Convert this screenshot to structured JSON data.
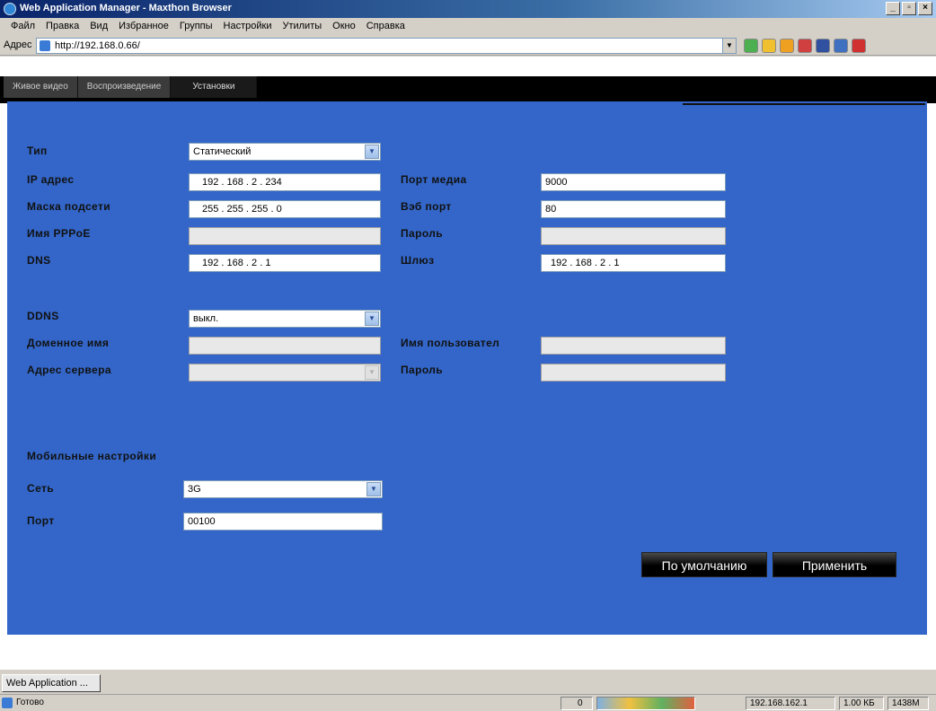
{
  "window": {
    "title": "Web Application Manager - Maxthon Browser",
    "minimize": "_",
    "maximize": "▫",
    "close": "×"
  },
  "menu": [
    "Файл",
    "Правка",
    "Вид",
    "Избранное",
    "Группы",
    "Настройки",
    "Утилиты",
    "Окно",
    "Справка"
  ],
  "address": {
    "label": "Адрес",
    "url": "http://192.168.0.66/"
  },
  "tabs": [
    {
      "label": "Живое видео"
    },
    {
      "label": "Воспроизведение"
    },
    {
      "label": "Установки",
      "active": true
    }
  ],
  "network": {
    "type_label": "Тип",
    "type_value": "Статический",
    "ip_label": "IP адрес",
    "ip_value": "192  .  168  .   2   .  234",
    "mask_label": "Маска подсети",
    "mask_value": "255  .  255  .  255  .   0",
    "pppoe_label": "Имя PPPoE",
    "pppoe_value": "",
    "dns_label": "DNS",
    "dns_value": "192  .  168  .   2   .   1",
    "media_port_label": "Порт медиа",
    "media_port_value": "9000",
    "web_port_label": "Вэб порт",
    "web_port_value": "80",
    "password_label": "Пароль",
    "password_value": "",
    "gateway_label": "Шлюз",
    "gateway_value": "192  .  168  .   2   .   1"
  },
  "ddns": {
    "ddns_label": "DDNS",
    "ddns_value": "выкл.",
    "domain_label": "Доменное имя",
    "domain_value": "",
    "server_label": "Адрес сервера",
    "server_value": "",
    "user_label": "Имя пользовател",
    "user_value": "",
    "password_label": "Пароль",
    "password_value": ""
  },
  "mobile": {
    "section_label": "Мобильные настройки",
    "network_label": "Сеть",
    "network_value": "3G",
    "port_label": "Порт",
    "port_value": "00100"
  },
  "buttons": {
    "default": "По умолчанию",
    "apply": "Применить"
  },
  "taskbar": {
    "app": "Web Application ..."
  },
  "status": {
    "text": "Готово",
    "counter": "0",
    "ip": "192.168.162.1",
    "size": "1.00 КБ",
    "mem": "1438М"
  },
  "colors": {
    "panel": "#3366c8",
    "nav": "#000000"
  }
}
